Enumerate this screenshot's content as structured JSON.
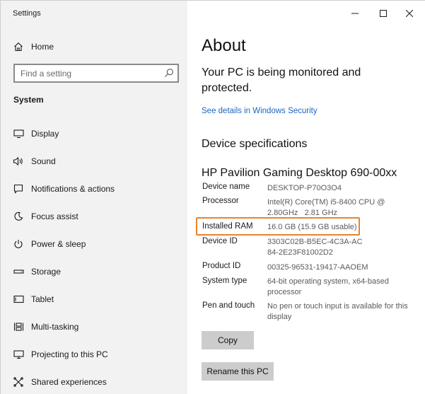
{
  "window": {
    "title": "Settings"
  },
  "sidebar": {
    "home": {
      "label": "Home",
      "icon": "home-icon"
    },
    "search": {
      "placeholder": "Find a setting",
      "icon": "search-icon"
    },
    "section_title": "System",
    "items": [
      {
        "label": "Display",
        "icon": "display-icon"
      },
      {
        "label": "Sound",
        "icon": "speaker-icon"
      },
      {
        "label": "Notifications & actions",
        "icon": "notification-icon"
      },
      {
        "label": "Focus assist",
        "icon": "moon-icon"
      },
      {
        "label": "Power & sleep",
        "icon": "power-icon"
      },
      {
        "label": "Storage",
        "icon": "storage-icon"
      },
      {
        "label": "Tablet",
        "icon": "tablet-icon"
      },
      {
        "label": "Multi-tasking",
        "icon": "multitasking-icon"
      },
      {
        "label": "Projecting to this PC",
        "icon": "projector-icon"
      },
      {
        "label": "Shared experiences",
        "icon": "shared-icon"
      }
    ]
  },
  "main": {
    "title": "About",
    "notice": "Your PC is being monitored and protected.",
    "security_link": "See details in Windows Security",
    "device_specs_heading": "Device specifications",
    "device_title": "HP Pavilion Gaming Desktop 690-00xx",
    "specs": [
      {
        "label": "Device name",
        "value": "DESKTOP-P70O3O4"
      },
      {
        "label": "Processor",
        "value": "Intel(R) Core(TM) i5-8400 CPU @ 2.80GHz   2.81 GHz"
      },
      {
        "label": "Installed RAM",
        "value": "16.0 GB (15.9 GB usable)"
      },
      {
        "label": "Device ID",
        "value": "3303C02B-B5EC-4C3A-AC84-2E23F81002D2"
      },
      {
        "label": "Product ID",
        "value": "00325-96531-19417-AAOEM"
      },
      {
        "label": "System type",
        "value": "64-bit operating system, x64-based processor"
      },
      {
        "label": "Pen and touch",
        "value": "No pen or touch input is available for this display"
      }
    ],
    "copy_label": "Copy",
    "rename_label": "Rename this PC"
  },
  "colors": {
    "highlight": "#e8832a",
    "link": "#1a66c2",
    "sidebar_bg": "#f2f2f2"
  }
}
